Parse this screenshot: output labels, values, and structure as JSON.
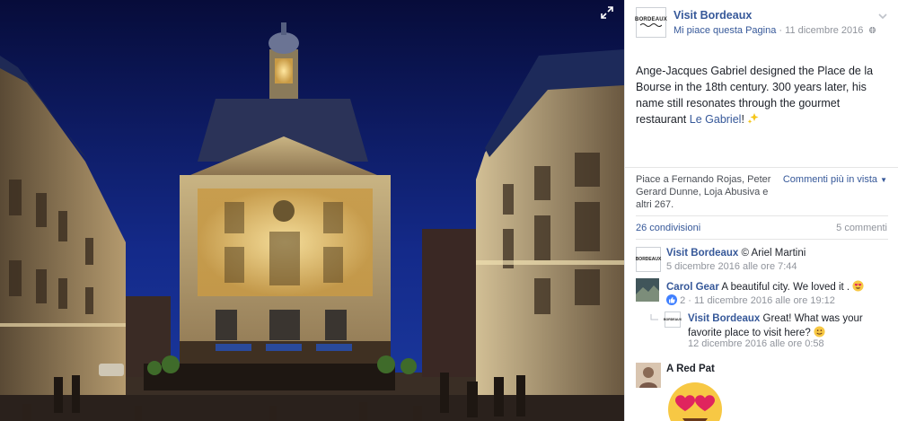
{
  "photo": {
    "alt": "Place de la Bourse, Bordeaux, at night"
  },
  "post": {
    "page_name": "Visit Bordeaux",
    "logo_text": "BORDEAUX",
    "like_page": "Mi piace questa Pagina",
    "date_sep": " · ",
    "date": "11 dicembre 2016",
    "caption_text": "Ange-Jacques Gabriel designed the Place de la Bourse in the 18th century. 300 years later, his name still resonates through the gourmet restaurant ",
    "caption_link": "Le Gabriel",
    "caption_end": "! ",
    "likes_text": "Piace a Fernando Rojas, Peter Gerard Dunne, Loja Abusiva e altri 267.",
    "sort_label": "Commenti più in vista",
    "shares": "26 condivisioni",
    "comments_count": "5 commenti"
  },
  "comments": [
    {
      "name": "Visit Bordeaux",
      "text": " © Ariel Martini",
      "meta": "5 dicembre 2016 alle ore 7:44"
    },
    {
      "name": "Carol Gear",
      "text": " A beautiful city. We loved it .",
      "reactions": "2",
      "meta": " · 11 dicembre 2016 alle ore 19:12"
    },
    {
      "name": "Visit Bordeaux",
      "text": " Great! What was your favorite place to visit here?",
      "meta": "12 dicembre 2016 alle ore 0:58"
    },
    {
      "name": "A Red Pat",
      "text": ""
    }
  ],
  "colors": {
    "link": "#365899",
    "meta": "#90949c",
    "text": "#1d2129"
  },
  "icons": [
    "expand-icon",
    "chevron-down-icon",
    "globe-icon",
    "sparkles-icon",
    "like-reaction-icon",
    "heart-eyes-emoji",
    "smile-emoji"
  ]
}
